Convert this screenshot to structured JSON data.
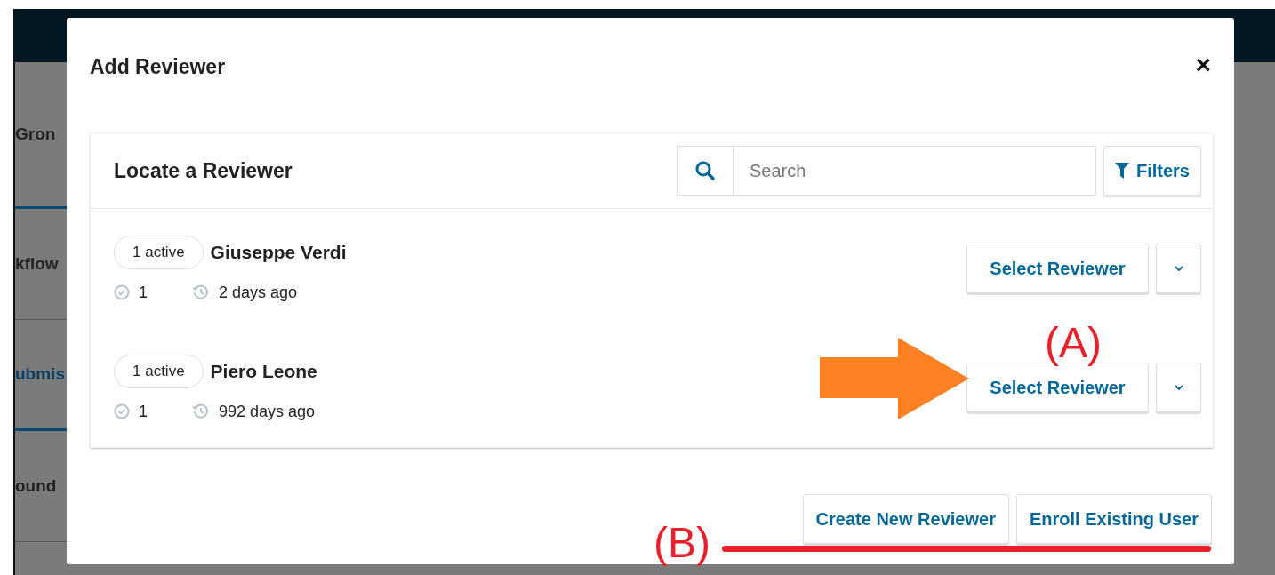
{
  "background": {
    "nav_items": [
      {
        "label": "Gron",
        "kind": "text"
      },
      {
        "label": "kflow",
        "kind": "text"
      },
      {
        "label": "ubmis",
        "kind": "link"
      },
      {
        "label": "ound",
        "kind": "text"
      }
    ]
  },
  "dialog": {
    "title": "Add Reviewer",
    "close": "×",
    "panel": {
      "title": "Locate a Reviewer",
      "search": {
        "placeholder": "Search"
      },
      "filters_button": "Filters",
      "reviewers": [
        {
          "badge": "1 active",
          "name": "Giuseppe Verdi",
          "completed": "1",
          "last_activity": "2 days ago",
          "select_button": "Select Reviewer"
        },
        {
          "badge": "1 active",
          "name": "Piero Leone",
          "completed": "1",
          "last_activity": "992 days ago",
          "select_button": "Select Reviewer"
        }
      ]
    },
    "footer_buttons": [
      "Create New Reviewer",
      "Enroll Existing User"
    ]
  },
  "annotations": [
    {
      "kind": "arrow-label",
      "label": "(A)"
    },
    {
      "kind": "underline-label",
      "label": "(B)"
    }
  ]
}
